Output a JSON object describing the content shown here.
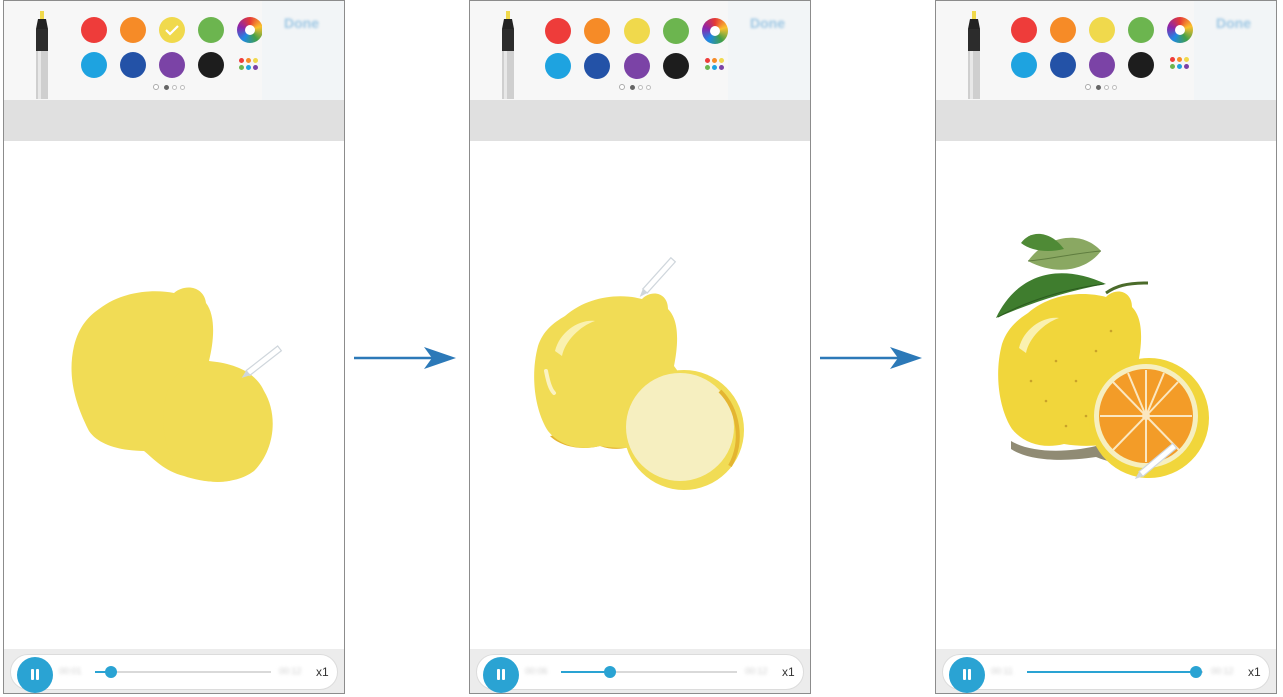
{
  "panels": [
    {
      "done_label": "Done",
      "elapsed": "00:01",
      "total": "00:12",
      "progress": 0.09,
      "speed_label": "x1",
      "selected_color": "yellow"
    },
    {
      "done_label": "Done",
      "elapsed": "00:06",
      "total": "00:12",
      "progress": 0.28,
      "speed_label": "x1",
      "selected_color": "none"
    },
    {
      "done_label": "Done",
      "elapsed": "00:11",
      "total": "00:12",
      "progress": 0.96,
      "speed_label": "x1",
      "selected_color": "none"
    }
  ],
  "palette": {
    "row1": [
      {
        "name": "red",
        "hex": "#ee3c3a"
      },
      {
        "name": "orange",
        "hex": "#f68b27"
      },
      {
        "name": "yellow",
        "hex": "#f0d94c"
      },
      {
        "name": "green",
        "hex": "#6cb54f"
      }
    ],
    "row2": [
      {
        "name": "light-blue",
        "hex": "#1ea3e0"
      },
      {
        "name": "blue",
        "hex": "#2352a7"
      },
      {
        "name": "purple",
        "hex": "#7b43a6"
      },
      {
        "name": "black",
        "hex": "#1d1d1d"
      }
    ]
  },
  "accent_color": "#2aa3d3",
  "arrow_color": "#2c79b8"
}
